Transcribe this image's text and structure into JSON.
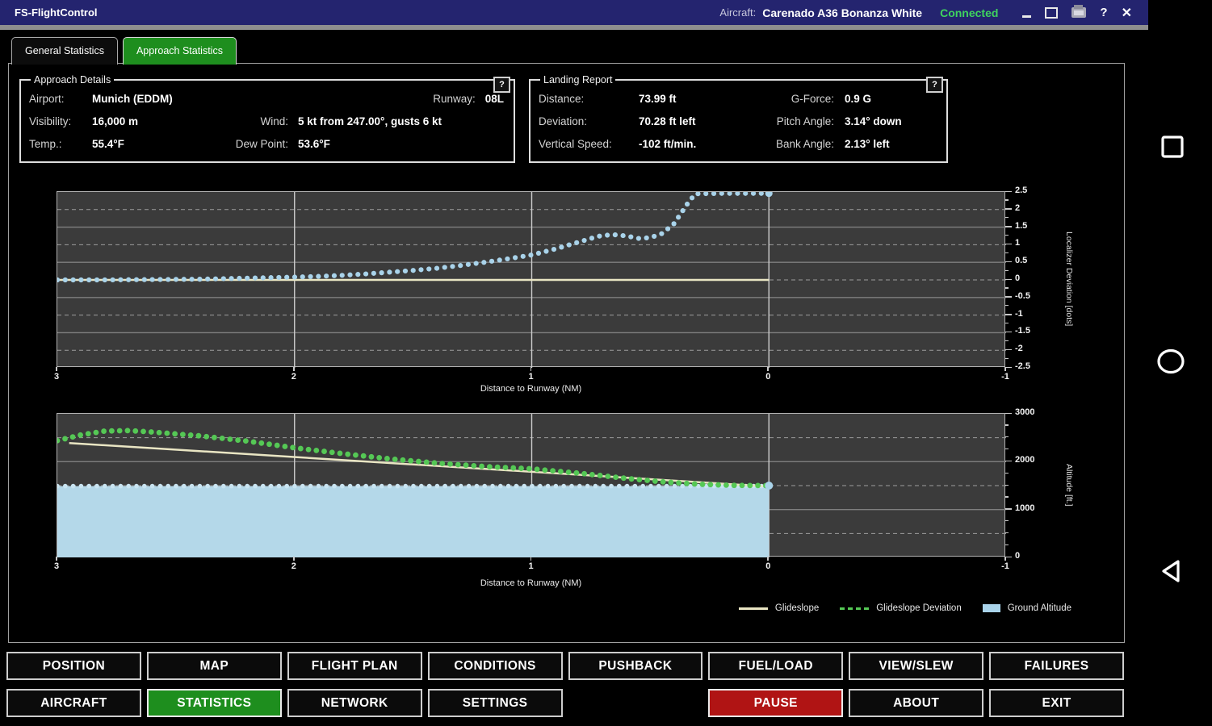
{
  "titlebar": {
    "app_name": "FS-FlightControl",
    "aircraft_label": "Aircraft:",
    "aircraft_value": "Carenado A36 Bonanza White",
    "connection_status": "Connected",
    "help_glyph": "?",
    "close_glyph": "✕"
  },
  "tabs": {
    "general": "General Statistics",
    "approach": "Approach Statistics"
  },
  "approach_details": {
    "title": "Approach Details",
    "help": "?",
    "airport_label": "Airport:",
    "airport": "Munich (EDDM)",
    "runway_label": "Runway:",
    "runway": "08L",
    "visibility_label": "Visibility:",
    "visibility": "16,000 m",
    "wind_label": "Wind:",
    "wind": "5 kt from 247.00°, gusts 6 kt",
    "temp_label": "Temp.:",
    "temp": "55.4°F",
    "dew_label": "Dew Point:",
    "dew": "53.6°F"
  },
  "landing_report": {
    "title": "Landing Report",
    "help": "?",
    "distance_label": "Distance:",
    "distance": "73.99 ft",
    "gforce_label": "G-Force:",
    "gforce": "0.9 G",
    "deviation_label": "Deviation:",
    "deviation": "70.28 ft left",
    "pitch_label": "Pitch Angle:",
    "pitch": "3.14° down",
    "vspeed_label": "Vertical Speed:",
    "vspeed": "-102 ft/min.",
    "bank_label": "Bank Angle:",
    "bank": "2.13° left"
  },
  "colors": {
    "titlebar": "#24246f",
    "tab_active": "#1e8e1e",
    "pause_red": "#b01414",
    "connected_green": "#3fd45f",
    "plot_bg": "#3b3b3b",
    "localizer_dots": "#a9d3ea",
    "glideslope_line": "#e9e5c3",
    "glideslope_dev": "#55c855",
    "ground_fill": "#b4d8e9"
  },
  "chart_data": [
    {
      "type": "line",
      "title": "",
      "xlabel": "Distance to Runway (NM)",
      "ylabel": "Localizer Deviation [dots]",
      "xlim": [
        3,
        -1
      ],
      "ylim": [
        -2.5,
        2.5
      ],
      "x_ticks": [
        [
          3,
          "3"
        ],
        [
          2,
          "2"
        ],
        [
          1,
          "1"
        ],
        [
          0,
          "0"
        ],
        [
          -1,
          "-1"
        ]
      ],
      "y_ticks": [
        [
          2.5,
          "2.5"
        ],
        [
          2,
          "2"
        ],
        [
          1.5,
          "1.5"
        ],
        [
          1,
          "1"
        ],
        [
          0.5,
          "0.5"
        ],
        [
          0,
          "0"
        ],
        [
          -0.5,
          "-0.5"
        ],
        [
          -1,
          "-1"
        ],
        [
          -1.5,
          "-1.5"
        ],
        [
          -2,
          "-2"
        ],
        [
          -2.5,
          "-2.5"
        ]
      ],
      "y_minor": [
        2.25,
        1.75,
        1.25,
        0.75,
        0.25,
        -0.25,
        -0.75,
        -1.25,
        -1.75,
        -2.25
      ],
      "grid": {
        "x_solid": [
          2,
          1,
          0
        ],
        "y_solid": [
          1.5,
          0.5,
          -0.5,
          -1.5
        ],
        "y_dashed": [
          2,
          1,
          0,
          -1,
          -2
        ]
      },
      "series": [
        {
          "name": "localizer-center",
          "style": "line",
          "color": "#e9e5c3",
          "width": 2.5,
          "points": [
            [
              3,
              0
            ],
            [
              0,
              0
            ]
          ]
        },
        {
          "name": "localizer-deviation",
          "style": "dots",
          "color": "#a9d3ea",
          "r": 3.1,
          "points": [
            [
              3,
              0
            ],
            [
              2.8,
              0
            ],
            [
              2.6,
              0.01
            ],
            [
              2.4,
              0.02
            ],
            [
              2.2,
              0.05
            ],
            [
              2.0,
              0.08
            ],
            [
              1.9,
              0.1
            ],
            [
              1.8,
              0.13
            ],
            [
              1.7,
              0.17
            ],
            [
              1.6,
              0.22
            ],
            [
              1.5,
              0.27
            ],
            [
              1.4,
              0.33
            ],
            [
              1.3,
              0.41
            ],
            [
              1.2,
              0.5
            ],
            [
              1.1,
              0.6
            ],
            [
              1.0,
              0.71
            ],
            [
              0.9,
              0.88
            ],
            [
              0.8,
              1.08
            ],
            [
              0.72,
              1.24
            ],
            [
              0.66,
              1.29
            ],
            [
              0.6,
              1.25
            ],
            [
              0.55,
              1.18
            ],
            [
              0.5,
              1.2
            ],
            [
              0.45,
              1.32
            ],
            [
              0.4,
              1.6
            ],
            [
              0.37,
              1.9
            ],
            [
              0.34,
              2.2
            ],
            [
              0.31,
              2.45
            ],
            [
              0.2,
              2.46
            ],
            [
              0.1,
              2.46
            ],
            [
              0,
              2.46
            ]
          ]
        },
        {
          "name": "touchdown-marker",
          "style": "dot",
          "color": "#a9d3ea",
          "r": 4.5,
          "points": [
            [
              0,
              2.46
            ]
          ]
        }
      ]
    },
    {
      "type": "line",
      "title": "",
      "xlabel": "Distance to Runway (NM)",
      "ylabel": "Altitude [ft.]",
      "xlim": [
        3,
        -1
      ],
      "ylim": [
        0,
        3000
      ],
      "x_ticks": [
        [
          3,
          "3"
        ],
        [
          2,
          "2"
        ],
        [
          1,
          "1"
        ],
        [
          0,
          "0"
        ],
        [
          -1,
          "-1"
        ]
      ],
      "y_ticks": [
        [
          3000,
          "3000"
        ],
        [
          2000,
          "2000"
        ],
        [
          1000,
          "1000"
        ],
        [
          0,
          "0"
        ]
      ],
      "y_minor": [
        2750,
        2500,
        2250,
        1750,
        1500,
        1250,
        750,
        500,
        250
      ],
      "grid": {
        "x_solid": [
          2,
          1,
          0
        ],
        "y_solid": [
          2000,
          1000
        ],
        "y_dashed": [
          2500,
          1500,
          500
        ]
      },
      "series": [
        {
          "name": "ground-altitude-area",
          "style": "area",
          "color": "#b4d8e9",
          "points": [
            [
              3,
              1490
            ],
            [
              0,
              1490
            ]
          ]
        },
        {
          "name": "ground-altitude-top",
          "style": "dots",
          "color": "#c9e4f1",
          "r": 2.8,
          "points": [
            [
              3,
              1490
            ],
            [
              0,
              1490
            ]
          ]
        },
        {
          "name": "glideslope",
          "style": "line",
          "color": "#e9e5c3",
          "width": 2.5,
          "points": [
            [
              2.95,
              2390
            ],
            [
              0,
              1480
            ]
          ]
        },
        {
          "name": "glideslope-deviation",
          "style": "dots",
          "color": "#55c855",
          "r": 3.4,
          "points": [
            [
              3,
              2440
            ],
            [
              2.9,
              2560
            ],
            [
              2.8,
              2640
            ],
            [
              2.7,
              2650
            ],
            [
              2.6,
              2620
            ],
            [
              2.4,
              2540
            ],
            [
              2.2,
              2430
            ],
            [
              2.0,
              2290
            ],
            [
              1.8,
              2170
            ],
            [
              1.6,
              2060
            ],
            [
              1.4,
              1970
            ],
            [
              1.2,
              1900
            ],
            [
              1.0,
              1850
            ],
            [
              0.8,
              1760
            ],
            [
              0.6,
              1650
            ],
            [
              0.45,
              1580
            ],
            [
              0.3,
              1530
            ],
            [
              0.15,
              1505
            ],
            [
              0,
              1500
            ]
          ]
        },
        {
          "name": "touchdown-marker",
          "style": "dot",
          "color": "#a9d3ea",
          "r": 5,
          "points": [
            [
              0,
              1500
            ]
          ]
        }
      ],
      "legend": [
        {
          "label": "Glideslope",
          "swatch": "line"
        },
        {
          "label": "Glideslope Deviation",
          "swatch": "dashes"
        },
        {
          "label": "Ground Altitude",
          "swatch": "box"
        }
      ]
    }
  ],
  "buttons": {
    "position": "POSITION",
    "map": "MAP",
    "flight_plan": "FLIGHT PLAN",
    "conditions": "CONDITIONS",
    "pushback": "PUSHBACK",
    "fuel_load": "FUEL/LOAD",
    "view_slew": "VIEW/SLEW",
    "failures": "FAILURES",
    "aircraft": "AIRCRAFT",
    "statistics": "STATISTICS",
    "network": "NETWORK",
    "settings": "SETTINGS",
    "pause": "PAUSE",
    "about": "ABOUT",
    "exit": "EXIT"
  }
}
